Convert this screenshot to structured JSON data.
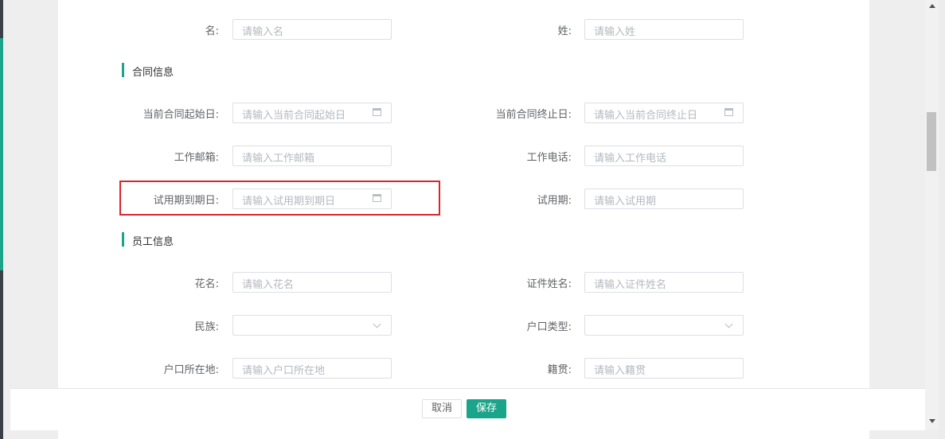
{
  "form": {
    "rows": [
      {
        "left_label": "名:",
        "left_placeholder": "请输入名",
        "right_label": "姓:",
        "right_placeholder": "请输入姓"
      }
    ],
    "sections": {
      "contract": "合同信息",
      "employee": "员工信息"
    },
    "contract": {
      "start_label": "当前合同起始日:",
      "start_placeholder": "请输入当前合同起始日",
      "end_label": "当前合同终止日:",
      "end_placeholder": "请输入当前合同终止日",
      "email_label": "工作邮箱:",
      "email_placeholder": "请输入工作邮箱",
      "phone_label": "工作电话:",
      "phone_placeholder": "请输入工作电话",
      "probation_end_label": "试用期到期日:",
      "probation_end_placeholder": "请输入试用期到期日",
      "probation_label": "试用期:",
      "probation_placeholder": "请输入试用期"
    },
    "employee": {
      "nickname_label": "花名:",
      "nickname_placeholder": "请输入花名",
      "id_name_label": "证件姓名:",
      "id_name_placeholder": "请输入证件姓名",
      "ethnicity_label": "民族:",
      "ethnicity_value": "",
      "hukou_type_label": "户口类型:",
      "hukou_type_value": "",
      "hukou_location_label": "户口所在地:",
      "hukou_location_placeholder": "请输入户口所在地",
      "native_place_label": "籍贯:",
      "native_place_placeholder": "请输入籍贯"
    }
  },
  "footer": {
    "cancel_label": "取消",
    "save_label": "保存"
  },
  "colors": {
    "accent": "#1aa58a",
    "highlight": "#d9262c"
  }
}
